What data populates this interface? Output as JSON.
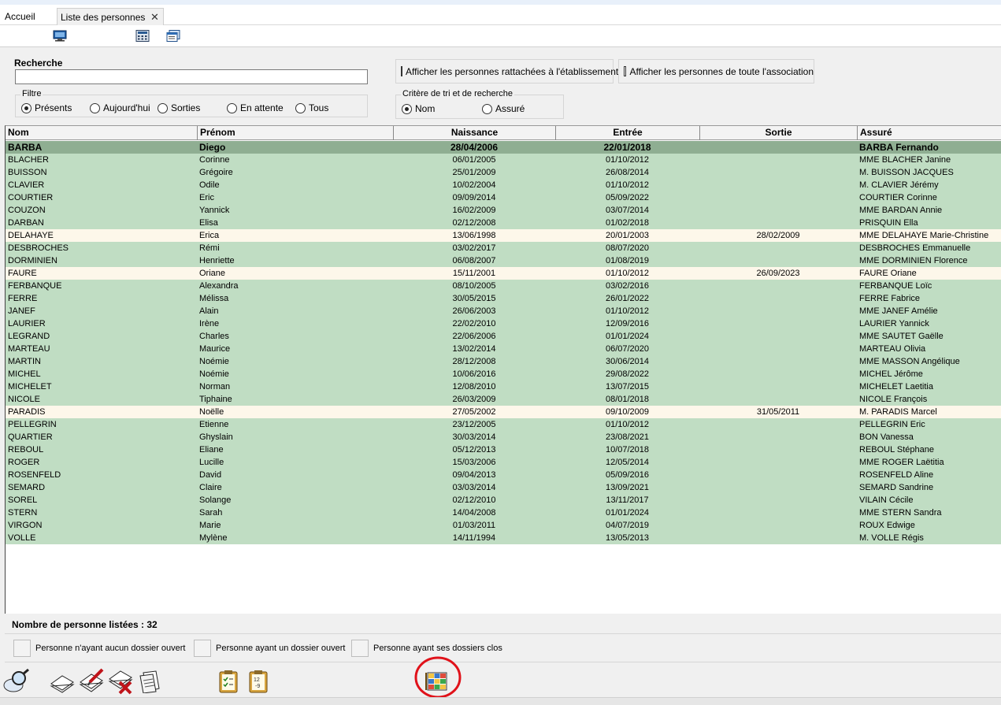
{
  "tabs": {
    "home": "Accueil",
    "active": "Liste des personnes",
    "close": "✕"
  },
  "search": {
    "label": "Recherche",
    "value": ""
  },
  "filter": {
    "title": "Filtre",
    "options": [
      "Présents",
      "Aujourd'hui",
      "Sorties",
      "En attente",
      "Tous"
    ],
    "selected": "Présents"
  },
  "checkboxes": {
    "etablissement": "Afficher les personnes rattachées à l'établissement",
    "association": "Afficher les personnes de toute l'association"
  },
  "sort": {
    "title": "Critère de tri et de recherche",
    "options": [
      "Nom",
      "Assuré"
    ],
    "selected": "Nom"
  },
  "columns": {
    "nom": "Nom",
    "prenom": "Prénom",
    "naissance": "Naissance",
    "entree": "Entrée",
    "sortie": "Sortie",
    "assure": "Assuré"
  },
  "rows": [
    [
      "BARBA",
      "Diego",
      "28/04/2006",
      "22/01/2018",
      "",
      "BARBA Fernando"
    ],
    [
      "BLACHER",
      "Corinne",
      "06/01/2005",
      "01/10/2012",
      "",
      "MME BLACHER Janine"
    ],
    [
      "BUISSON",
      "Grégoire",
      "25/01/2009",
      "26/08/2014",
      "",
      "M. BUISSON JACQUES"
    ],
    [
      "CLAVIER",
      "Odile",
      "10/02/2004",
      "01/10/2012",
      "",
      "M. CLAVIER Jérémy"
    ],
    [
      "COURTIER",
      "Eric",
      "09/09/2014",
      "05/09/2022",
      "",
      "COURTIER Corinne"
    ],
    [
      "COUZON",
      "Yannick",
      "16/02/2009",
      "03/07/2014",
      "",
      "MME BARDAN Annie"
    ],
    [
      "DARBAN",
      "Elisa",
      "02/12/2008",
      "01/02/2018",
      "",
      "PRISQUIN Ella"
    ],
    [
      "DELAHAYE",
      "Erica",
      "13/06/1998",
      "20/01/2003",
      "28/02/2009",
      "MME DELAHAYE Marie-Christine"
    ],
    [
      "DESBROCHES",
      "Rémi",
      "03/02/2017",
      "08/07/2020",
      "",
      "DESBROCHES Emmanuelle"
    ],
    [
      "DORMINIEN",
      "Henriette",
      "06/08/2007",
      "01/08/2019",
      "",
      "MME DORMINIEN Florence"
    ],
    [
      "FAURE",
      "Oriane",
      "15/11/2001",
      "01/10/2012",
      "26/09/2023",
      "FAURE Oriane"
    ],
    [
      "FERBANQUE",
      "Alexandra",
      "08/10/2005",
      "03/02/2016",
      "",
      "FERBANQUE Loïc"
    ],
    [
      "FERRE",
      "Mélissa",
      "30/05/2015",
      "26/01/2022",
      "",
      "FERRE  Fabrice"
    ],
    [
      "JANEF",
      "Alain",
      "26/06/2003",
      "01/10/2012",
      "",
      "MME JANEF Amélie"
    ],
    [
      "LAURIER",
      "Irène",
      "22/02/2010",
      "12/09/2016",
      "",
      "LAURIER Yannick"
    ],
    [
      "LEGRAND",
      "Charles",
      "22/06/2006",
      "01/01/2024",
      "",
      "MME SAUTET  Gaëlle"
    ],
    [
      "MARTEAU",
      "Maurice",
      "13/02/2014",
      "06/07/2020",
      "",
      "MARTEAU Olivia"
    ],
    [
      "MARTIN",
      "Noémie",
      "28/12/2008",
      "30/06/2014",
      "",
      "MME MASSON Angélique"
    ],
    [
      "MICHEL",
      "Noémie",
      "10/06/2016",
      "29/08/2022",
      "",
      "MICHEL Jérôme"
    ],
    [
      "MICHELET",
      "Norman",
      "12/08/2010",
      "13/07/2015",
      "",
      "MICHELET Laetitia"
    ],
    [
      "NICOLE",
      "Tiphaine",
      "26/03/2009",
      "08/01/2018",
      "",
      "NICOLE François"
    ],
    [
      "PARADIS",
      "Noëlle",
      "27/05/2002",
      "09/10/2009",
      "31/05/2011",
      "M. PARADIS Marcel"
    ],
    [
      "PELLEGRIN",
      "Etienne",
      "23/12/2005",
      "01/10/2012",
      "",
      "PELLEGRIN Eric"
    ],
    [
      "QUARTIER",
      "Ghyslain",
      "30/03/2014",
      "23/08/2021",
      "",
      "BON Vanessa"
    ],
    [
      "REBOUL",
      "Eliane",
      "05/12/2013",
      "10/07/2018",
      "",
      "REBOUL Stéphane"
    ],
    [
      "ROGER",
      "Lucille",
      "15/03/2006",
      "12/05/2014",
      "",
      "MME ROGER Laëtitia"
    ],
    [
      "ROSENFELD",
      "David",
      "09/04/2013",
      "05/09/2016",
      "",
      "ROSENFELD Aline"
    ],
    [
      "SEMARD",
      "Claire",
      "03/03/2014",
      "13/09/2021",
      "",
      "SEMARD Sandrine"
    ],
    [
      "SOREL",
      "Solange",
      "02/12/2010",
      "13/11/2017",
      "",
      "VILAIN Cécile"
    ],
    [
      "STERN",
      "Sarah",
      "14/04/2008",
      "01/01/2024",
      "",
      "MME STERN Sandra"
    ],
    [
      "VIRGON",
      "Marie",
      "01/03/2011",
      "04/07/2019",
      "",
      "ROUX  Edwige"
    ],
    [
      "VOLLE",
      "Mylène",
      "14/11/1994",
      "13/05/2013",
      "",
      "M. VOLLE Régis"
    ]
  ],
  "selected_row": 0,
  "count_label": "Nombre de personne listées : 32",
  "legend": {
    "none_open": "Personne n'ayant aucun dossier ouvert",
    "one_open": "Personne ayant un dossier ouvert",
    "closed": "Personne ayant ses dossiers clos"
  },
  "colors": {
    "row_green": "#c0ddc3",
    "row_white": "#fdf7ea",
    "row_selected": "#8fae92",
    "highlight_circle": "#e0121a"
  },
  "icons": {
    "toolbar": [
      "monitor-icon",
      "calculator-icon",
      "window-list-icon"
    ],
    "bottom": [
      "magnifier-icon",
      "documents-icon",
      "edit-document-icon",
      "delete-document-icon",
      "notes-icon",
      "checklist-icon",
      "numbered-list-icon",
      "color-grid-icon"
    ]
  }
}
